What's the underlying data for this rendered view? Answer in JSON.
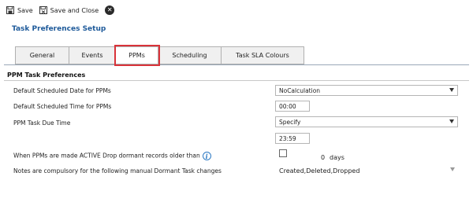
{
  "toolbar": {
    "save_label": "Save",
    "save_close_label": "Save and Close"
  },
  "page": {
    "title": "Task Preferences Setup"
  },
  "tabs": [
    {
      "label": "General",
      "active": false
    },
    {
      "label": "Events",
      "active": false
    },
    {
      "label": "PPMs",
      "active": true
    },
    {
      "label": "Scheduling",
      "active": false
    },
    {
      "label": "Task SLA Colours",
      "active": false
    }
  ],
  "section": {
    "title": "PPM Task Preferences"
  },
  "fields": {
    "default_date": {
      "label": "Default Scheduled Date for PPMs",
      "value": "NoCalculation"
    },
    "default_time": {
      "label": "Default Scheduled Time for PPMs",
      "value": "00:00"
    },
    "due_time": {
      "label": "PPM Task Due Time",
      "value": "Specify",
      "time_value": "23:59"
    },
    "dormant": {
      "label": "When PPMs are made ACTIVE Drop dormant records older than",
      "checked": false,
      "count": "0",
      "unit": "days"
    },
    "notes": {
      "label": "Notes are compulsory for the following manual Dormant Task changes",
      "value": "Created,Deleted,Dropped"
    }
  },
  "icons": {
    "save": "save-icon",
    "save_close": "save-close-icon",
    "close": "close-icon",
    "info": "info-icon"
  },
  "colors": {
    "title": "#1e5a9a",
    "active_tab_outline": "#d9333a",
    "info": "#2d7ac4"
  }
}
